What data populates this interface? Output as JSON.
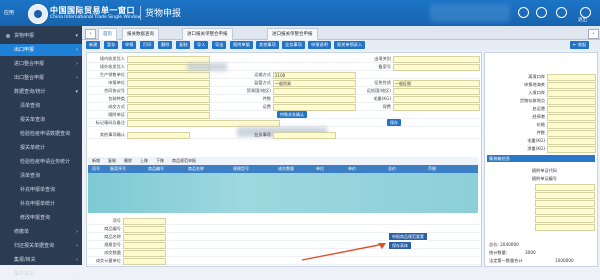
{
  "header": {
    "app": "应用",
    "brand_cn": "中国国际贸易单一窗口",
    "brand_en": "China International Trade Single Window",
    "module": "货物申报",
    "exit": "退出"
  },
  "sidebar": {
    "items": [
      {
        "label": "货物申报",
        "active": false
      },
      {
        "label": "出口申报",
        "active": true
      },
      {
        "label": "进口整合申报",
        "active": false
      },
      {
        "label": "出口整合申报",
        "active": false
      },
      {
        "label": "数据查询/统计",
        "active": false
      },
      {
        "label": "清单查询",
        "active": false
      },
      {
        "label": "报关单查询",
        "active": false
      },
      {
        "label": "检验检疫申请数据查询",
        "active": false
      },
      {
        "label": "报关单统计",
        "active": false
      },
      {
        "label": "检验检疫申请业务统计",
        "active": false
      },
      {
        "label": "清单查询",
        "active": false
      },
      {
        "label": "补充申报单查询",
        "active": false
      },
      {
        "label": "补充申报单统计",
        "active": false
      },
      {
        "label": "修改申报查询",
        "active": false
      },
      {
        "label": "修撤单",
        "active": false
      },
      {
        "label": "归还报关单据查询",
        "active": false
      },
      {
        "label": "集报/转关",
        "active": false
      },
      {
        "label": "集中报关",
        "active": false
      }
    ]
  },
  "tabs": [
    "首页",
    "报关数据查询",
    "进口报关单整合申报",
    "进口报关单整合申报"
  ],
  "toolbar": [
    "新建",
    "暂存",
    "申报",
    "打印",
    "删除",
    "复制",
    "导入",
    "导出",
    "随附单据",
    "其他事项",
    "业务事项",
    "申报说明",
    "报关单预录入"
  ],
  "form": {
    "rows": [
      {
        "l1": "境内收发货人",
        "l2": "",
        "l3": "出境关别",
        "v3": ""
      },
      {
        "l1": "境外收发货人",
        "l2": "",
        "l3": "备案号",
        "v3": ""
      },
      {
        "l1": "生产销售单位",
        "l2": "运输方式",
        "v2": "2100",
        "l3": "",
        "v3": ""
      },
      {
        "l1": "申报单位",
        "l2": "监管方式",
        "v2": "一般贸易",
        "l3": "征免性质",
        "v3": "一般征税"
      },
      {
        "l1": "合同协议号",
        "l2": "贸易国(地区)",
        "v2": "",
        "l3": "运抵国(地区)",
        "v3": ""
      },
      {
        "l1": "包装种类",
        "l2": "件数",
        "v2": "",
        "l3": "毛重(KG)",
        "v3": ""
      },
      {
        "l1": "成交方式",
        "l2": "运费",
        "v2": "",
        "l3": "保费",
        "v3": ""
      },
      {
        "l1": "随附单证",
        "l2": "",
        "l3": "",
        "v3": ""
      },
      {
        "l1": "标记唛码及备注",
        "l2": "",
        "l3": "",
        "v3": ""
      }
    ],
    "check_label": "特殊关系确认",
    "save_button": "保存",
    "other_label": "其他事项确认",
    "business_label": "业务事项"
  },
  "grid": {
    "tools": [
      "新增",
      "复制",
      "删除",
      "上移",
      "下移",
      "商品规范申报"
    ],
    "headers": [
      "项号",
      "备案序号",
      "商品编号",
      "商品名称",
      "规格型号",
      "成交数量",
      "单位",
      "单价",
      "总价",
      "币制"
    ],
    "row_labels": [
      "项号",
      "商品编号",
      "商品名称",
      "规格型号",
      "成交数量",
      "成交计量单位",
      "法定第一数量",
      "法定第二数量"
    ]
  },
  "callouts": {
    "first": "申报商品规范要素",
    "second": "保存表体"
  },
  "right_panel": {
    "rows": [
      "离境口岸",
      "申报地海关",
      "入境口岸",
      "货物存放地点",
      "启运港",
      "经停港",
      "价格",
      "件数",
      "毛重(KG)",
      "净重(KG)"
    ],
    "section": "集装箱信息",
    "list": [
      "随附单证代码",
      "随附单证编号",
      "",
      "",
      "",
      "",
      "",
      "",
      "",
      "",
      "",
      ""
    ],
    "totals": {
      "total_amount": "总价: 2040000",
      "count_label": "统计数量:",
      "count_value": "3000",
      "first_qty": "法定第一数量合计",
      "first_value": "1000000",
      "second_qty": "法定第二数量合计",
      "second_value": "3"
    }
  }
}
